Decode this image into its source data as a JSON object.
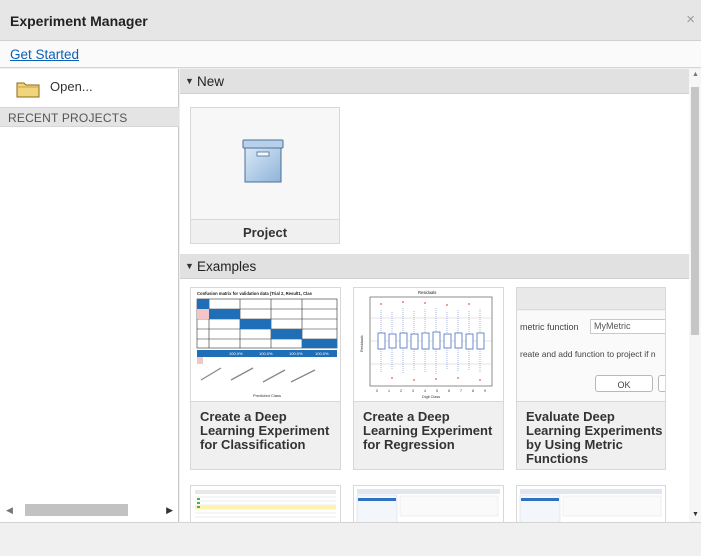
{
  "window": {
    "title": "Experiment Manager",
    "close_glyph": "×"
  },
  "links": {
    "get_started": "Get Started"
  },
  "sidebar": {
    "open_label": "Open...",
    "open_icon": "folder-icon",
    "recent_header": "RECENT PROJECTS"
  },
  "sections": {
    "new": {
      "label": "New",
      "tiles": [
        {
          "caption": "Project",
          "icon": "project-box-icon"
        }
      ]
    },
    "examples": {
      "label": "Examples",
      "tiles": [
        {
          "caption_lines": [
            "Create a Deep",
            "Learning Experiment",
            "for Classification"
          ],
          "thumb": {
            "title": "Confusion matrix for validation data (Trial 2, Result1, Clas",
            "percents": [
              "100.0%",
              "100.0%",
              "100.0%",
              "100.0%"
            ],
            "x_axis_label": "Predicted Class",
            "y_axis_label": "True Class"
          }
        },
        {
          "caption_lines": [
            "Create a Deep",
            "Learning Experiment",
            "for Regression"
          ],
          "thumb": {
            "title": "Residuals",
            "x_axis_label": "Digit Class",
            "y_axis_label": "Residuals",
            "x_ticks": [
              "0",
              "1",
              "2",
              "3",
              "4",
              "5",
              "6",
              "7",
              "8",
              "9"
            ]
          }
        },
        {
          "caption_lines": [
            "Evaluate Deep",
            "Learning Experiments",
            "by Using Metric",
            "Functions"
          ],
          "thumb": {
            "field_label": "metric function",
            "field_value": "MyMetric",
            "description": "reate and add function to project if n",
            "ok_button": "OK"
          }
        }
      ]
    }
  },
  "colors": {
    "link": "#0b61b8",
    "matrix_blue": "#1f6fb8",
    "matrix_pink": "#f4c5c5",
    "accent_gray": "#e1e1e1"
  }
}
